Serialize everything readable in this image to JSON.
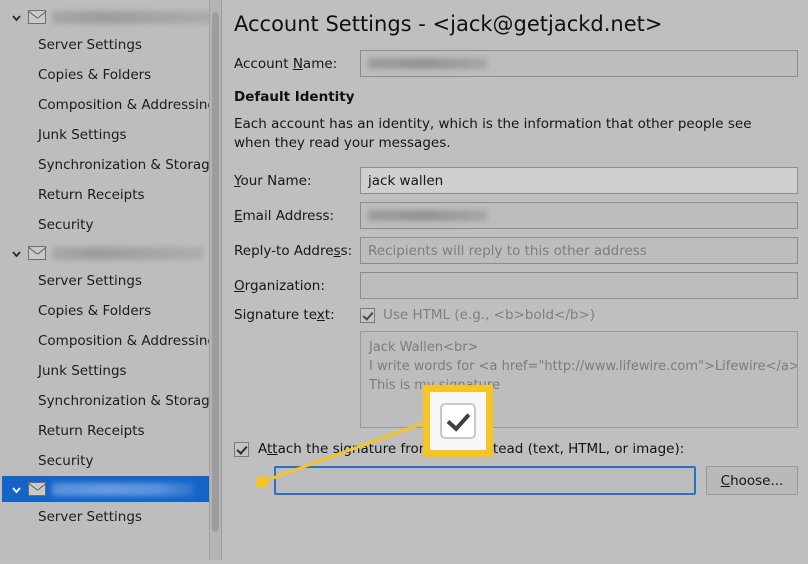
{
  "sidebar": {
    "accounts": [
      {
        "name_redacted": true,
        "expanded": true,
        "selected": false,
        "items": [
          {
            "label": "Server Settings"
          },
          {
            "label": "Copies & Folders"
          },
          {
            "label": "Composition & Addressing"
          },
          {
            "label": "Junk Settings"
          },
          {
            "label": "Synchronization & Storage"
          },
          {
            "label": "Return Receipts"
          },
          {
            "label": "Security"
          }
        ]
      },
      {
        "name_redacted": true,
        "expanded": true,
        "selected": false,
        "items": [
          {
            "label": "Server Settings"
          },
          {
            "label": "Copies & Folders"
          },
          {
            "label": "Composition & Addressing"
          },
          {
            "label": "Junk Settings"
          },
          {
            "label": "Synchronization & Storage"
          },
          {
            "label": "Return Receipts"
          },
          {
            "label": "Security"
          }
        ]
      },
      {
        "name_redacted": true,
        "expanded": true,
        "selected": true,
        "items": [
          {
            "label": "Server Settings"
          }
        ]
      }
    ]
  },
  "main": {
    "title": "Account Settings - <jack@getjackd.net>",
    "account_name_label": "Account Name:",
    "account_name_value": "",
    "section_title": "Default Identity",
    "description": "Each account has an identity, which is the information that other people see when they read your messages.",
    "fields": {
      "your_name_label": "Your Name:",
      "your_name_value": "jack wallen",
      "email_label": "Email Address:",
      "email_value": "",
      "replyto_label": "Reply-to Address:",
      "replyto_placeholder": "Recipients will reply to this other address",
      "organization_label": "Organization:",
      "organization_value": "",
      "signature_label": "Signature text:",
      "use_html_label": "Use HTML (e.g., <b>bold</b>)",
      "use_html_checked": true,
      "signature_lines": [
        "Jack Wallen<br>",
        "I write words for <a href=\"http://www.lifewire.com\">Lifewire</a><br>",
        "This is my signature"
      ]
    },
    "attach": {
      "label": "Attach the signature from a file instead (text, HTML, or image):",
      "checked": true,
      "file_path": "",
      "choose_label": "Choose..."
    }
  },
  "annotation": {
    "accent_color": "#f6c524",
    "callout_icon": "checked-checkbox"
  }
}
